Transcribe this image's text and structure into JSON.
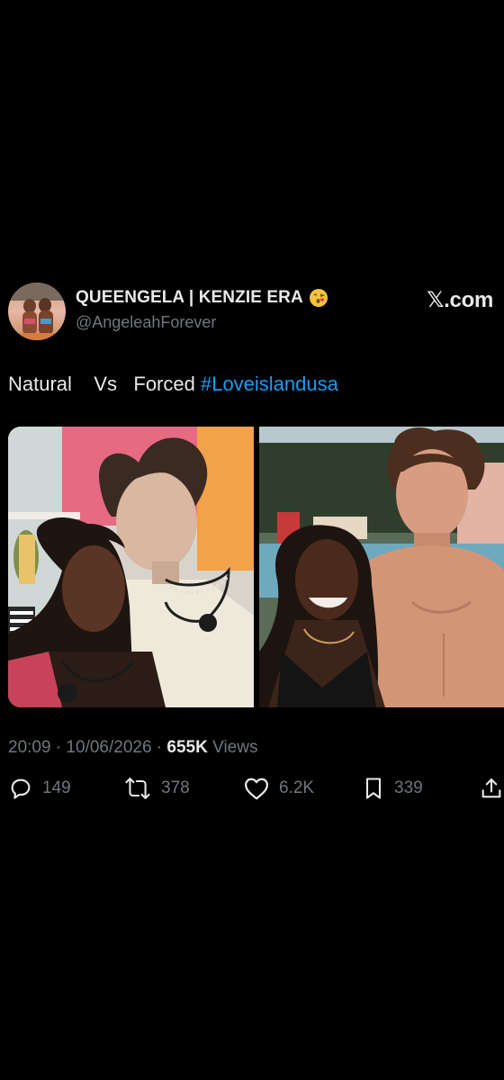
{
  "tweet": {
    "display_name": "QUEENGELA | KENZIE ERA",
    "handle": "@AngeleahForever",
    "site": "𝕏.com",
    "text_plain": "Natural    Vs   Forced ",
    "hashtag": "#Loveislandusa",
    "timestamp": "20:09 · 10/06/2026 · ",
    "views_count": "655K",
    "views_label": " Views"
  },
  "actions": {
    "replies": "149",
    "reposts": "378",
    "likes": "6.2K",
    "bookmarks": "339"
  },
  "icons": {
    "reply": "reply-icon",
    "repost": "repost-icon",
    "like": "heart-icon",
    "bookmark": "bookmark-icon",
    "share": "share-icon",
    "emoji": "kiss-emoji-icon"
  },
  "colors": {
    "background": "#000000",
    "text": "#e7e9ea",
    "muted": "#71767b",
    "hashtag": "#1d9bf0"
  }
}
